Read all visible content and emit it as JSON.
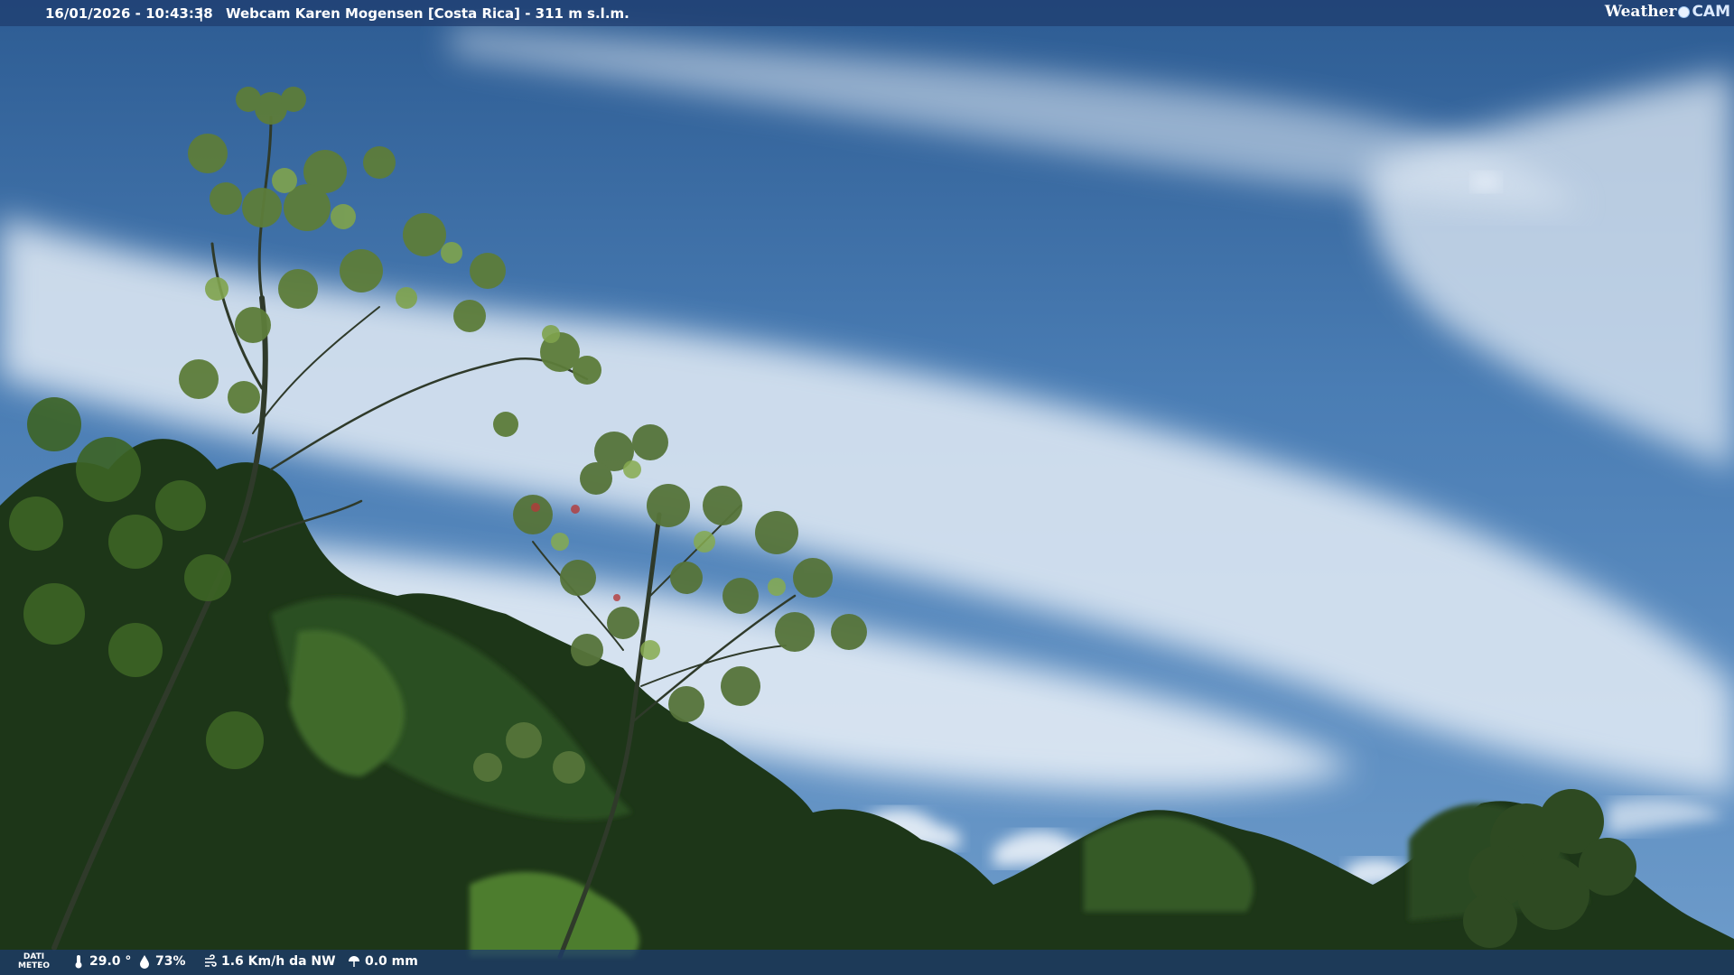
{
  "header": {
    "timestamp": "16/01/2026 - 10:43:38",
    "separator": "|",
    "title": "Webcam Karen Mogensen [Costa Rica] - 311 m s.l.m.",
    "brand_left": "Weather",
    "brand_right": "CAM"
  },
  "footer": {
    "meteo_label_line1": "DATI",
    "meteo_label_line2": "METEO",
    "temperature": "29.0 °",
    "humidity": "73%",
    "wind": "1.6 Km/h da NW",
    "rain": "0.0 mm"
  },
  "colors": {
    "sky_top": "#2e5f97",
    "sky_mid": "#5c8dc2",
    "cloud": "#e6eef7",
    "foliage_dark": "#1f3a1c",
    "foliage_light": "#6f9b3a",
    "bar": "#1e3c6e"
  },
  "icons": {
    "temperature": "thermometer-icon",
    "humidity": "droplet-icon",
    "wind": "wind-icon",
    "rain": "rain-icon",
    "brand": "sun-dot-icon"
  }
}
